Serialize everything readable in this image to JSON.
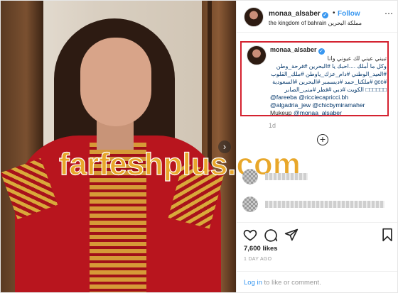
{
  "header": {
    "username": "monaa_alsaber",
    "separator": "•",
    "follow_label": "Follow",
    "location": "the kingdom of bahrain مملكة البحرين",
    "more_icon": "⋯"
  },
  "watermark": {
    "text": "farfeshplus.com",
    "brand_color": "#e8a72a"
  },
  "carousel": {
    "next_icon": "›"
  },
  "caption": {
    "username": "monaa_alsaber",
    "lines_ar": [
      "تبيني عيني لك عيوني وانا",
      "وكل ما أملك ....احبك يا #البحرين #فرحة_وطن",
      "#العيد_الوطني #دام_عزك_ياوطن #ملك_القلوب",
      "#gcc #ملكنا_حمد #ديسمبر #البحرين #السعودية",
      "□□□□□□ الكويت #دبي #قطر #منى_الصابر"
    ],
    "mentions_1": "@fareeba @ricciecapricci.bh",
    "mentions_2": "@algadria_jew @chicbymiramaher",
    "makeup_label": "Mukeup",
    "makeup_handle": "@monaa_alsaber"
  },
  "time_ago": "1d",
  "load_more_icon": "+",
  "actions": {
    "like_icon": "heart-icon",
    "comment_icon": "comment-icon",
    "share_icon": "share-icon",
    "save_icon": "bookmark-icon"
  },
  "likes": "7,600 likes",
  "post_date": "1 DAY AGO",
  "login": {
    "link": "Log in",
    "text": " to like or comment."
  }
}
